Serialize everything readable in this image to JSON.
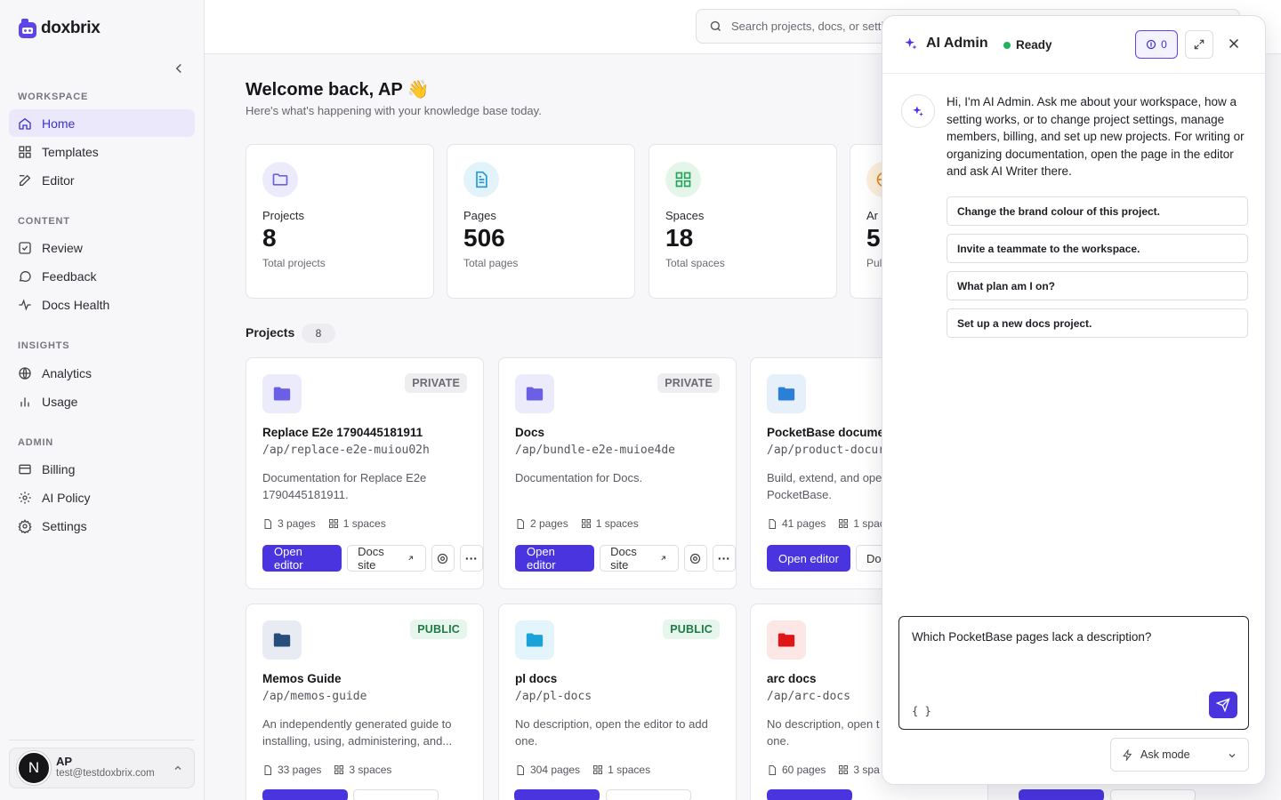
{
  "brand": {
    "name": "doxbrix",
    "accent": "#4a34e0"
  },
  "sidebar": {
    "sections": [
      {
        "title": "WORKSPACE",
        "items": [
          {
            "label": "Home",
            "icon": "home-icon",
            "active": true
          },
          {
            "label": "Templates",
            "icon": "templates-icon"
          },
          {
            "label": "Editor",
            "icon": "editor-icon"
          }
        ]
      },
      {
        "title": "CONTENT",
        "items": [
          {
            "label": "Review",
            "icon": "review-icon"
          },
          {
            "label": "Feedback",
            "icon": "feedback-icon"
          },
          {
            "label": "Docs Health",
            "icon": "pulse-icon"
          }
        ]
      },
      {
        "title": "INSIGHTS",
        "items": [
          {
            "label": "Analytics",
            "icon": "globe-icon"
          },
          {
            "label": "Usage",
            "icon": "bar-chart-icon"
          }
        ]
      },
      {
        "title": "ADMIN",
        "items": [
          {
            "label": "Billing",
            "icon": "billing-icon"
          },
          {
            "label": "AI Policy",
            "icon": "sun-icon"
          },
          {
            "label": "Settings",
            "icon": "gear-icon"
          }
        ]
      }
    ],
    "user": {
      "avatar": "N",
      "name": "AP",
      "email": "test@testdoxbrix.com"
    }
  },
  "search": {
    "placeholder": "Search projects, docs, or setti"
  },
  "main": {
    "welcome": "Welcome back, AP 👋",
    "subtitle": "Here's what's happening with your knowledge base today.",
    "stats": [
      {
        "label": "Projects",
        "value": "8",
        "desc": "Total projects",
        "color": "#6d5ee8",
        "bg": "#ecebfb"
      },
      {
        "label": "Pages",
        "value": "506",
        "desc": "Total pages",
        "color": "#1f9ad6",
        "bg": "#e3f3fb"
      },
      {
        "label": "Spaces",
        "value": "18",
        "desc": "Total spaces",
        "color": "#24a45a",
        "bg": "#e4f5ea"
      },
      {
        "label": "Ar",
        "value": "5",
        "desc": "Pul",
        "color": "#e08a18",
        "bg": "#fcefdc"
      }
    ],
    "projects_title": "Projects",
    "projects_count": "8",
    "projects": [
      {
        "name": "Replace E2e 1790445181911",
        "path": "/ap/replace-e2e-muiou02h",
        "desc": "Documentation for Replace E2e 1790445181911.",
        "pages": "3 pages",
        "spaces": "1 spaces",
        "badge": "PRIVATE",
        "color": "#6b5fe6",
        "bg": "#ecebfb"
      },
      {
        "name": "Docs",
        "path": "/ap/bundle-e2e-muioe4de",
        "desc": "Documentation for Docs.",
        "pages": "2 pages",
        "spaces": "1 spaces",
        "badge": "PRIVATE",
        "color": "#6b5fe6",
        "bg": "#ecebfb"
      },
      {
        "name": "PocketBase docume",
        "path": "/ap/product-docur",
        "desc": "Build, extend, and ope PocketBase.",
        "pages": "41 pages",
        "spaces": "1 spac",
        "badge": "",
        "color": "#2b7fd9",
        "bg": "#e6f0fb"
      },
      {
        "name": "Memos Guide",
        "path": "/ap/memos-guide",
        "desc": "An independently generated guide to installing, using, administering, and...",
        "pages": "33 pages",
        "spaces": "3 spaces",
        "badge": "PUBLIC",
        "color": "#274e7a",
        "bg": "#e8ecf2"
      },
      {
        "name": "pl docs",
        "path": "/ap/pl-docs",
        "desc": "No description, open the editor to add one.",
        "pages": "304 pages",
        "spaces": "1 spaces",
        "badge": "PUBLIC",
        "color": "#1aa3d9",
        "bg": "#e3f4fb"
      },
      {
        "name": "arc docs",
        "path": "/ap/arc-docs",
        "desc": "No description, open t one.",
        "pages": "60 pages",
        "spaces": "3 spa",
        "badge": "",
        "color": "#e01616",
        "bg": "#fde6e6"
      }
    ],
    "buttons": {
      "open_editor": "Open editor",
      "docs_site": "Docs site",
      "docs_site_clip": "Do"
    }
  },
  "ai": {
    "title": "AI Admin",
    "status": "Ready",
    "credits": "0",
    "intro": "Hi, I'm AI Admin. Ask me about your workspace, how a setting works, or to change project settings, manage members, billing, and set up new projects. For writing or organizing documentation, open the page in the editor and ask AI Writer there.",
    "suggestions": [
      "Change the brand colour of this project.",
      "Invite a teammate to the workspace.",
      "What plan am I on?",
      "Set up a new docs project."
    ],
    "input": "Which PocketBase pages lack a description?",
    "context_glyph": "{ }",
    "mode": "Ask mode"
  }
}
